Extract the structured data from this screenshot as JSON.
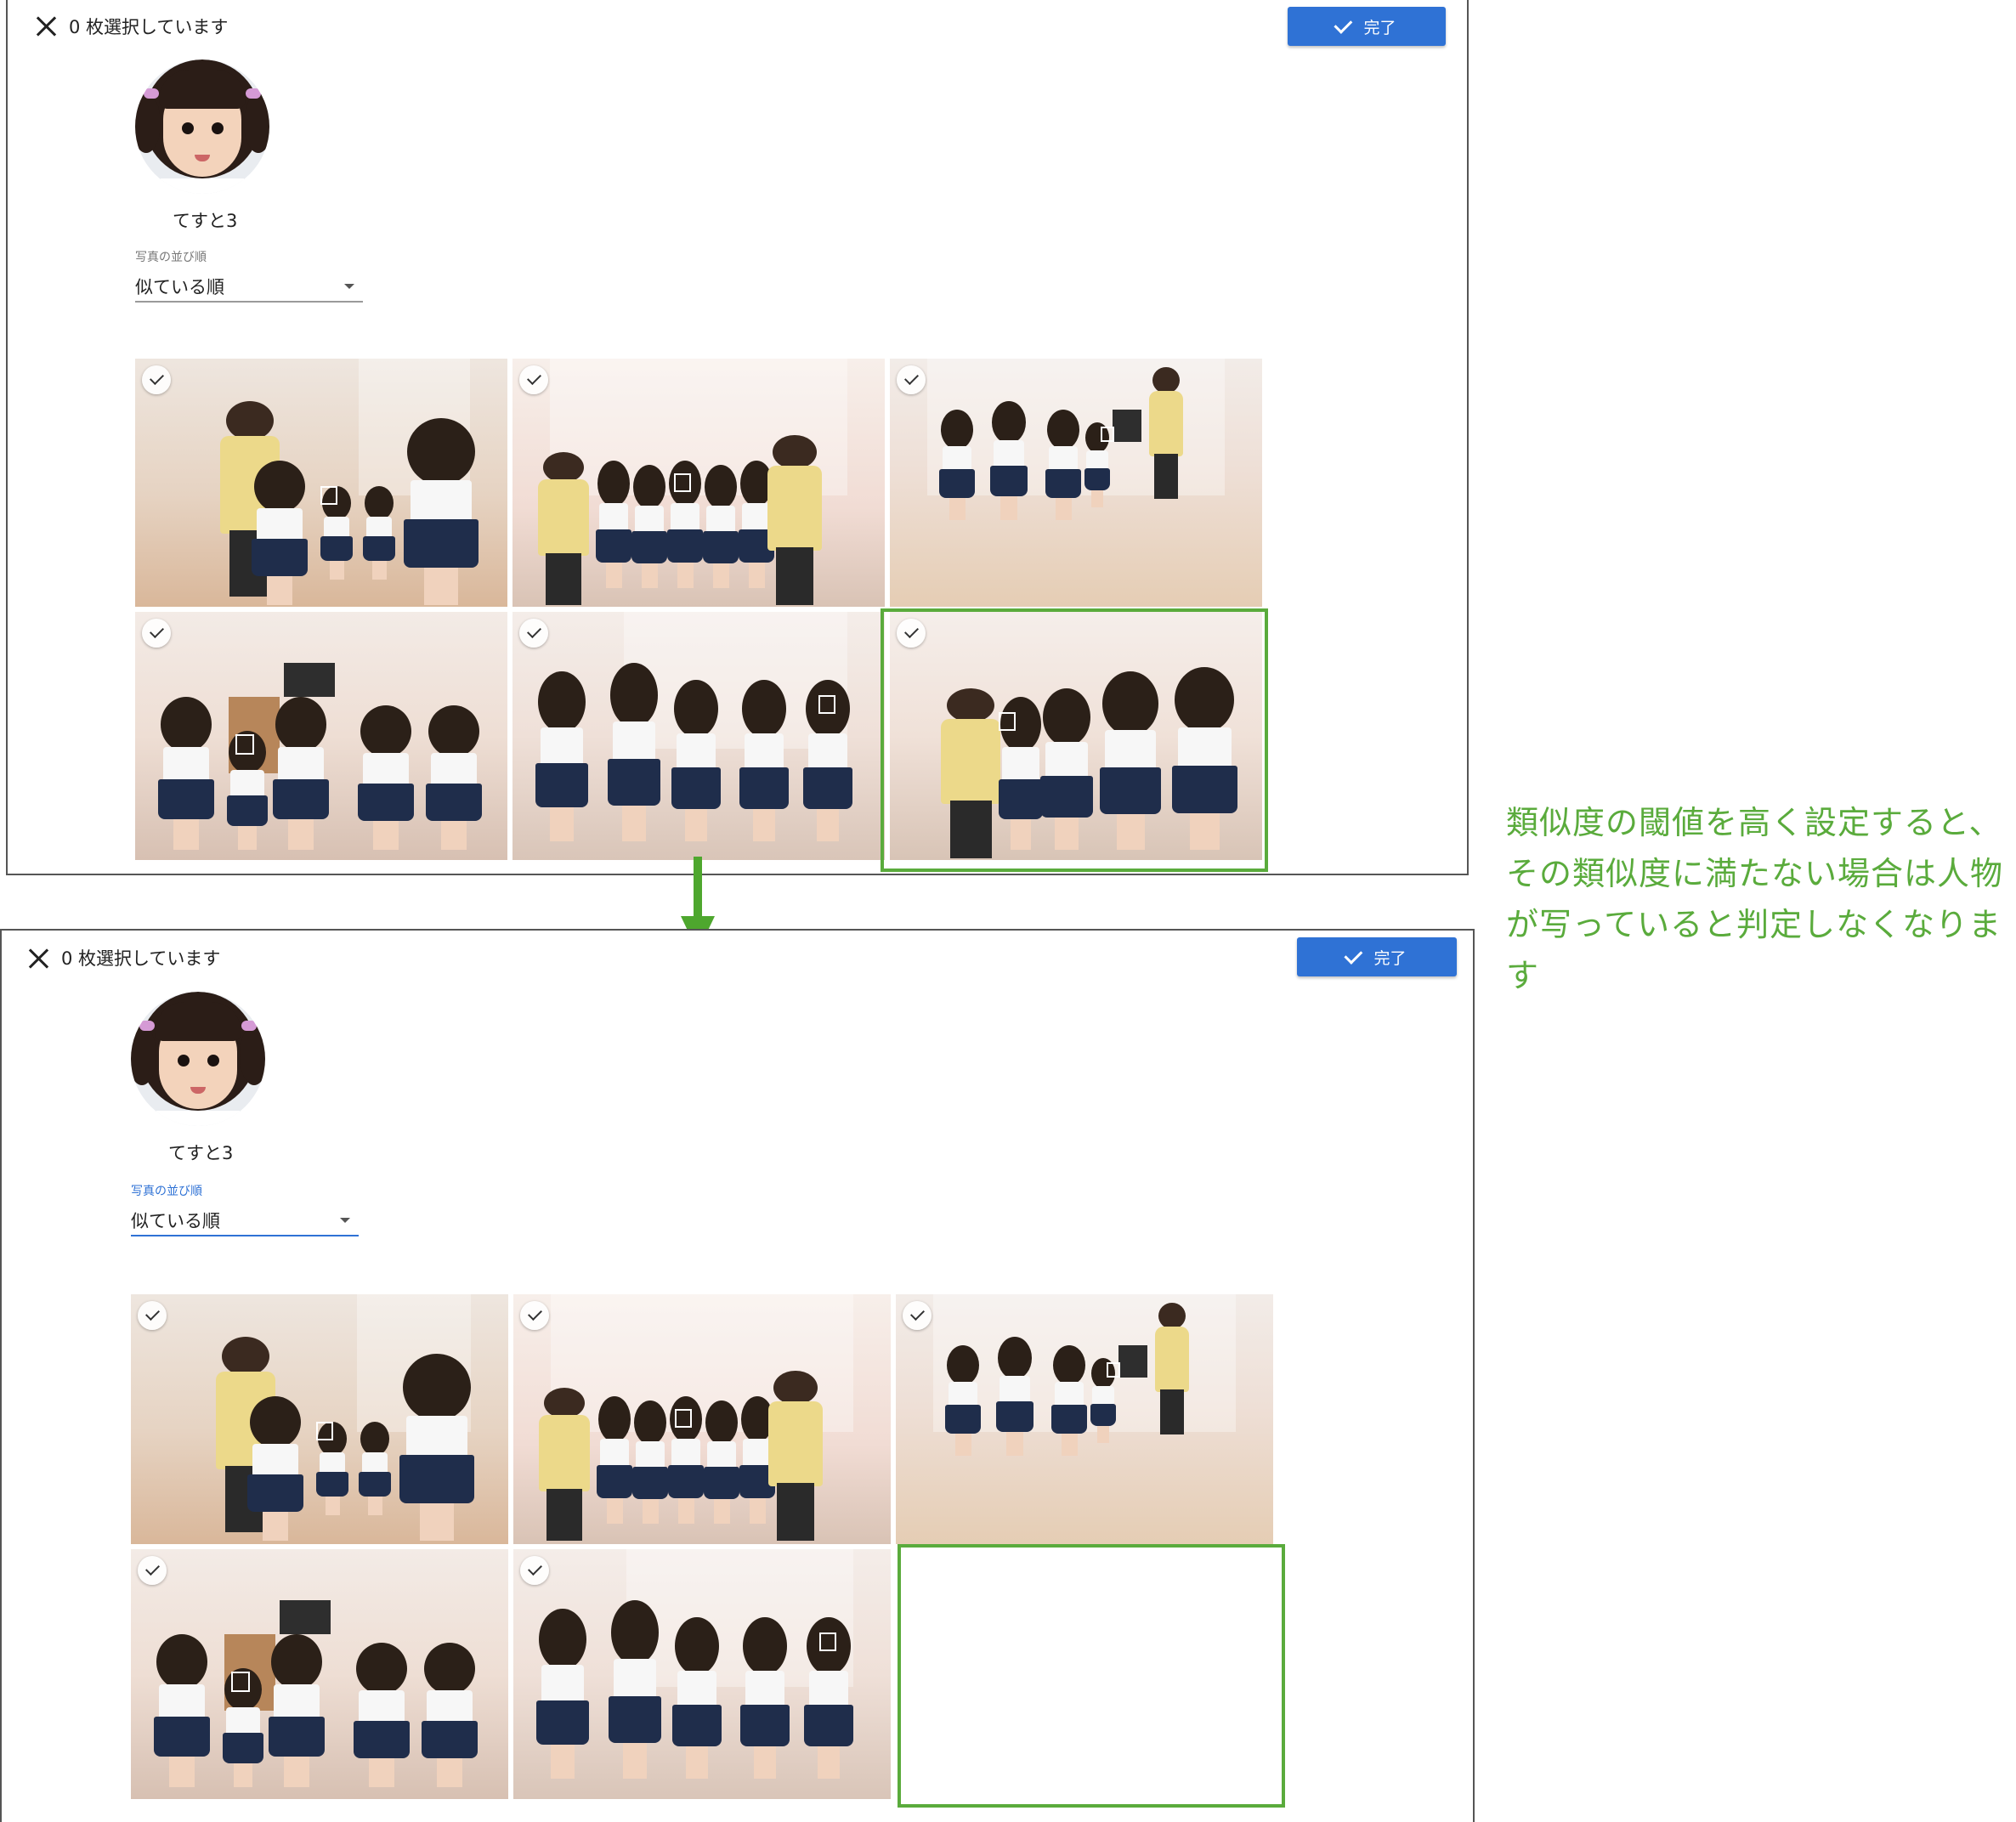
{
  "colors": {
    "accent": "#2f72d5",
    "highlight": "#5aab3c",
    "arrow": "#4ea72e"
  },
  "before": {
    "header": {
      "selected_count": "0 枚選択しています",
      "done_label": "完了"
    },
    "person": {
      "name": "てすと3"
    },
    "sort": {
      "label": "写真の並び順",
      "value": "似ている順"
    },
    "photos": [
      {
        "icon": "check-icon"
      },
      {
        "icon": "check-icon"
      },
      {
        "icon": "check-icon"
      },
      {
        "icon": "check-icon"
      },
      {
        "icon": "check-icon"
      },
      {
        "icon": "check-icon"
      }
    ]
  },
  "after": {
    "header": {
      "selected_count": "0 枚選択しています",
      "done_label": "完了"
    },
    "person": {
      "name": "てすと3"
    },
    "sort": {
      "label": "写真の並び順",
      "value": "似ている順"
    },
    "photos": [
      {
        "icon": "check-icon"
      },
      {
        "icon": "check-icon"
      },
      {
        "icon": "check-icon"
      },
      {
        "icon": "check-icon"
      },
      {
        "icon": "check-icon"
      }
    ]
  },
  "annotation": {
    "text": "類似度の閾値を高く設定すると、その類似度に満たない場合は人物が写っていると判定しなくなります"
  }
}
